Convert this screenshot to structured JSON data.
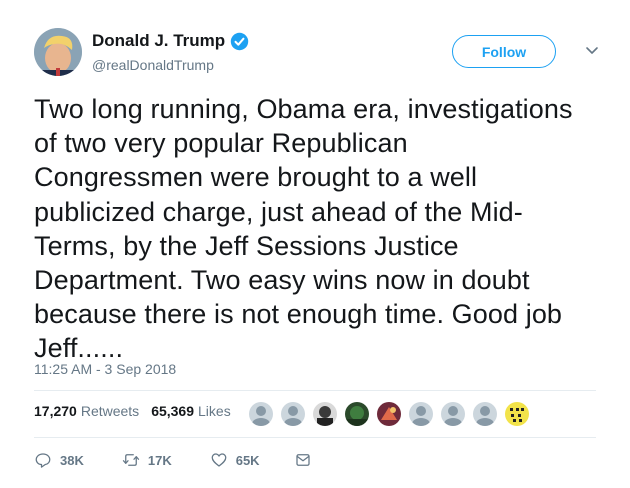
{
  "user": {
    "display_name": "Donald J. Trump",
    "handle": "@realDonaldTrump",
    "verified": true
  },
  "follow_button": {
    "label": "Follow"
  },
  "tweet": {
    "text": "Two long running, Obama era, investigations\nof  two very popular Republican\nCongressmen were brought to a well\npublicized charge, just ahead of the Mid-\nTerms, by the Jeff Sessions Justice\nDepartment. Two easy wins now in doubt\nbecause there is not enough time. Good job\nJeff......",
    "timestamp": "11:25 AM - 3 Sep 2018"
  },
  "stats": {
    "retweets_count": "17,270",
    "retweets_label": "Retweets",
    "likes_count": "65,369",
    "likes_label": "Likes"
  },
  "actions": {
    "replies": "38K",
    "retweets": "17K",
    "likes": "65K"
  },
  "icons": {
    "verified": "verified-badge-icon",
    "menu": "chevron-down-icon",
    "reply": "reply-icon",
    "retweet": "retweet-icon",
    "like": "heart-icon",
    "message": "envelope-icon"
  },
  "colors": {
    "accent": "#1da1f2",
    "text": "#14171a",
    "secondary": "#657786",
    "divider": "#e6ecf0"
  }
}
